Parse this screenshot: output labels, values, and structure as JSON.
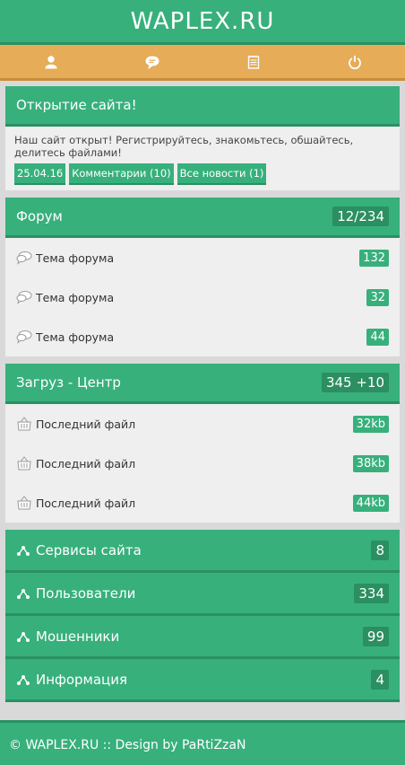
{
  "site": {
    "logo": "WAPLEX.RU"
  },
  "nav": [
    {
      "icon": "user-icon"
    },
    {
      "icon": "chat-icon"
    },
    {
      "icon": "notepad-icon"
    },
    {
      "icon": "power-icon"
    }
  ],
  "news": {
    "title": "Открытие сайта!",
    "text": "Наш сайт открыт! Регистрируйтесь, знакомьтесь, обшайтесь, делитесь файлами!",
    "date": "25.04.16",
    "comments": "Комментарии (10)",
    "all_news": "Все новости (1)"
  },
  "forum": {
    "title": "Форум",
    "count": "12/234",
    "items": [
      {
        "label": "Тема форума",
        "count": "132"
      },
      {
        "label": "Тема форума",
        "count": "32"
      },
      {
        "label": "Тема форума",
        "count": "44"
      }
    ]
  },
  "downloads": {
    "title": "Загруз - Центр",
    "count": "345 +10",
    "items": [
      {
        "label": "Последний файл",
        "size": "32kb"
      },
      {
        "label": "Последний файл",
        "size": "38kb"
      },
      {
        "label": "Последний файл",
        "size": "44kb"
      }
    ]
  },
  "menu": [
    {
      "label": "Сервисы сайта",
      "count": "8"
    },
    {
      "label": "Пользователи",
      "count": "334"
    },
    {
      "label": "Мошенники",
      "count": "99"
    },
    {
      "label": "Информация",
      "count": "4"
    }
  ],
  "footer": {
    "text": "© WAPLEX.RU :: Design by PaRtiZzaN"
  },
  "colors": {
    "green": "#37b07c",
    "green_dark": "#2a9064",
    "orange": "#e6ac58",
    "bg": "#efefef"
  }
}
